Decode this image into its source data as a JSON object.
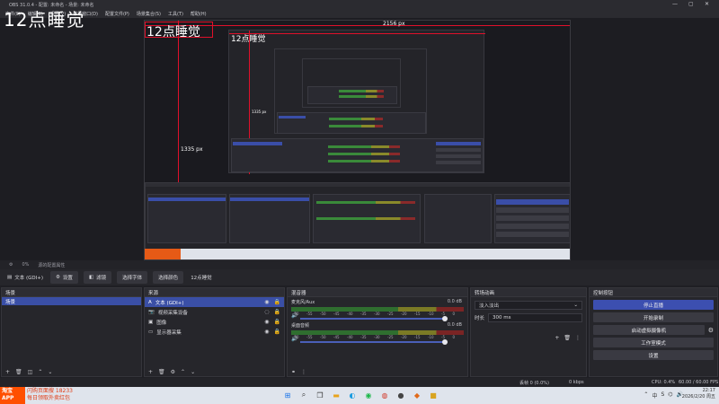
{
  "window": {
    "title": "OBS 31.0.4 - 配置: 未命名 - 场景: 未命名",
    "min": "—",
    "max": "▢",
    "close": "✕"
  },
  "menu": [
    "文件(F)",
    "编辑(E)",
    "视图(V)",
    "停靠窗口(D)",
    "配置文件(P)",
    "场景集合(S)",
    "工具(T)",
    "帮助(H)"
  ],
  "overlay_text": "12点睡觉",
  "preview": {
    "title_inner1": "12点睡觉",
    "title_inner2": "12点睡觉",
    "dim_width": "2156 px",
    "dim_height": "1335 px",
    "dim_height_small": "1335 px"
  },
  "source_bar": {
    "icon": "⚙",
    "label": "0%",
    "text": "源的配置属性"
  },
  "toolbar": {
    "source_name": "文本 (GDI+)",
    "properties": "设置",
    "filters": "滤镜",
    "select_font": "选择字体",
    "select_color": "选择颜色",
    "value": "12点睡觉"
  },
  "docks": {
    "scenes": {
      "title": "场景",
      "items": [
        "场景"
      ]
    },
    "sources": {
      "title": "来源",
      "items": [
        {
          "name": "文本 (GDI+)",
          "icon": "A",
          "selected": true
        },
        {
          "name": "视频采集设备",
          "icon": "📷",
          "selected": false
        },
        {
          "name": "图像",
          "icon": "▣",
          "selected": false
        },
        {
          "name": "显示器采集",
          "icon": "▭",
          "selected": false
        }
      ]
    },
    "mixer": {
      "title": "混音器",
      "channels": [
        {
          "name": "麦克风/Aux",
          "db": "0.0 dB"
        },
        {
          "name": "桌面音频",
          "db": "0.0 dB"
        }
      ],
      "scale": [
        "-60",
        "-55",
        "-50",
        "-45",
        "-40",
        "-35",
        "-30",
        "-25",
        "-20",
        "-15",
        "-10",
        "-5",
        "0"
      ]
    },
    "transitions": {
      "title": "转场动画",
      "type": "淡入淡出",
      "duration_label": "时长",
      "duration": "300 ms"
    },
    "controls": {
      "title": "控制按钮",
      "buttons": [
        "停止直播",
        "开始录制",
        "启动虚拟摄像机",
        "工作室模式",
        "设置"
      ]
    }
  },
  "status": {
    "dropped": "丢帧 0 (0.0%)",
    "time1": "00:00:00",
    "kbps": "0 kbps",
    "time2": "00:00:00",
    "cpu": "CPU: 0.4%",
    "fps": "60.00 / 60.00 FPS"
  },
  "taskbar": {
    "ad_label": "淘宝\nAPP",
    "ad_line1": "闪购页面搜 18233",
    "ad_line2": "每日领取外卖红包",
    "clock_time": "22:17",
    "clock_date": "2026/2/20 周五",
    "lang": "中",
    "ime": "S"
  }
}
